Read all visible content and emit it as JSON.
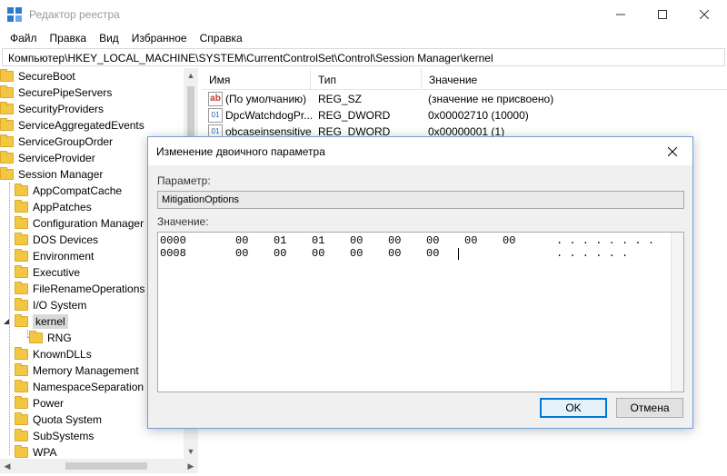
{
  "window": {
    "title": "Редактор реестра",
    "minimize": "—",
    "maximize": "☐",
    "close": "✕"
  },
  "menu": [
    "Файл",
    "Правка",
    "Вид",
    "Избранное",
    "Справка"
  ],
  "address": "Компьютер\\HKEY_LOCAL_MACHINE\\SYSTEM\\CurrentControlSet\\Control\\Session Manager\\kernel",
  "tree": {
    "top_level": [
      "SecureBoot",
      "SecurePipeServers",
      "SecurityProviders",
      "ServiceAggregatedEvents",
      "ServiceGroupOrder",
      "ServiceProvider",
      "Session Manager"
    ],
    "session_children_before": [
      "AppCompatCache",
      "AppPatches",
      "Configuration Manager",
      "DOS Devices",
      "Environment",
      "Executive",
      "FileRenameOperations",
      "I/O System"
    ],
    "selected": "kernel",
    "kernel_children": [
      "RNG"
    ],
    "session_children_after": [
      "KnownDLLs",
      "Memory Management",
      "NamespaceSeparation",
      "Power",
      "Quota System",
      "SubSystems",
      "WPA"
    ]
  },
  "list": {
    "columns": [
      "Имя",
      "Тип",
      "Значение"
    ],
    "rows": [
      {
        "icon": "ab",
        "name": "(По умолчанию)",
        "type": "REG_SZ",
        "value": "(значение не присвоено)"
      },
      {
        "icon": "binary",
        "name": "DpcWatchdogPr...",
        "type": "REG_DWORD",
        "value": "0x00002710 (10000)"
      },
      {
        "icon": "binary",
        "name": "obcaseinsensitive",
        "type": "REG_DWORD",
        "value": "0x00000001 (1)"
      }
    ]
  },
  "dialog": {
    "title": "Изменение двоичного параметра",
    "close": "✕",
    "param_label": "Параметр:",
    "param_value": "MitigationOptions",
    "value_label": "Значение:",
    "hex_rows": [
      {
        "offset": "0000",
        "bytes": [
          "00",
          "01",
          "01",
          "00",
          "00",
          "00",
          "00",
          "00"
        ],
        "ascii": ". . . . . . . ."
      },
      {
        "offset": "0008",
        "bytes": [
          "00",
          "00",
          "00",
          "00",
          "00",
          "00"
        ],
        "ascii": ". . . . . ."
      }
    ],
    "ok": "OK",
    "cancel": "Отмена"
  },
  "colors": {
    "accent": "#0078d7",
    "folder": "#f2c744",
    "selection": "#d9d9d9"
  }
}
